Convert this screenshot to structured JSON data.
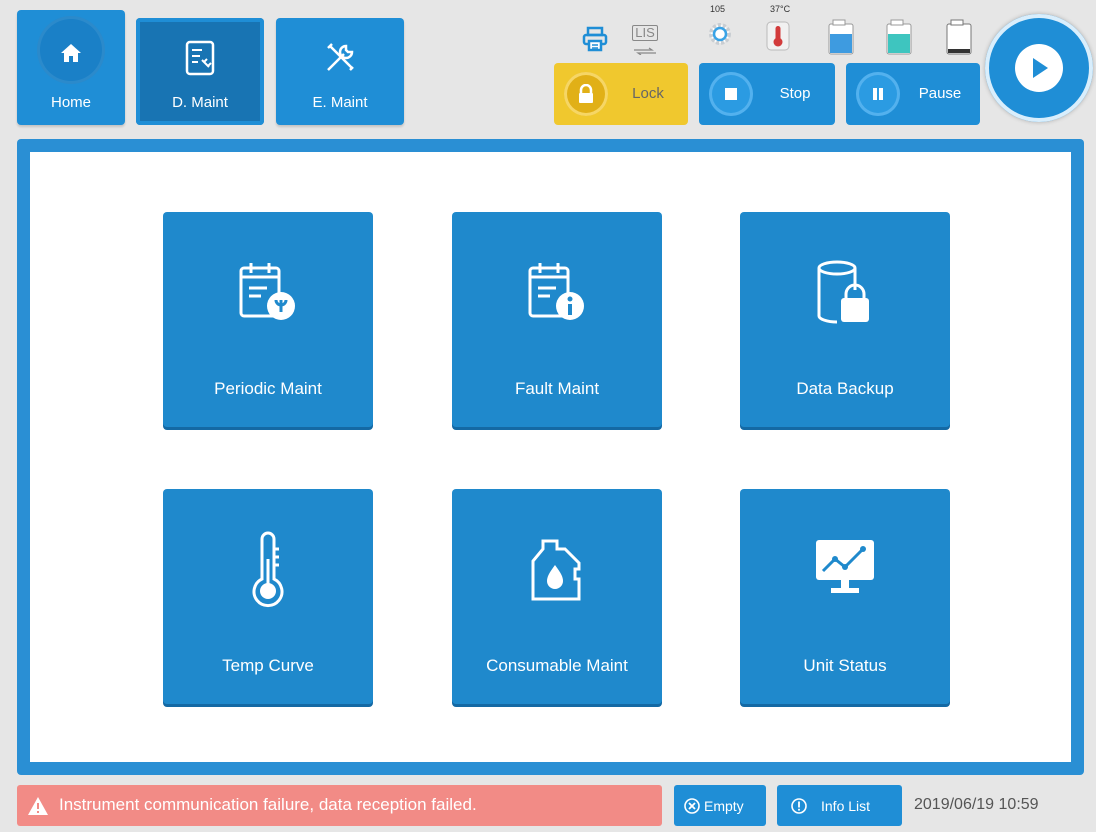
{
  "nav": {
    "home_label": "Home",
    "dmaint_label": "D. Maint",
    "emaint_label": "E. Maint"
  },
  "status": {
    "lis_label": "LIS",
    "counter_value": "105",
    "temperature": "37°C"
  },
  "controls": {
    "lock_label": "Lock",
    "stop_label": "Stop",
    "pause_label": "Pause"
  },
  "tiles": [
    {
      "label": "Periodic Maint",
      "icon": "calendar-wrench-icon"
    },
    {
      "label": "Fault Maint",
      "icon": "calendar-info-icon"
    },
    {
      "label": "Data Backup",
      "icon": "database-lock-icon"
    },
    {
      "label": "Temp Curve",
      "icon": "thermometer-icon"
    },
    {
      "label": "Consumable Maint",
      "icon": "reagent-bottle-icon"
    },
    {
      "label": "Unit Status",
      "icon": "monitor-chart-icon"
    }
  ],
  "footer": {
    "alert_message": "Instrument communication failure, data reception failed.",
    "empty_label": "Empty",
    "infolist_label": "Info List",
    "datetime": "2019/06/19 10:59"
  },
  "colors": {
    "primary": "#1f8ed6",
    "lock": "#f0c82e",
    "alert": "#f28b86"
  }
}
